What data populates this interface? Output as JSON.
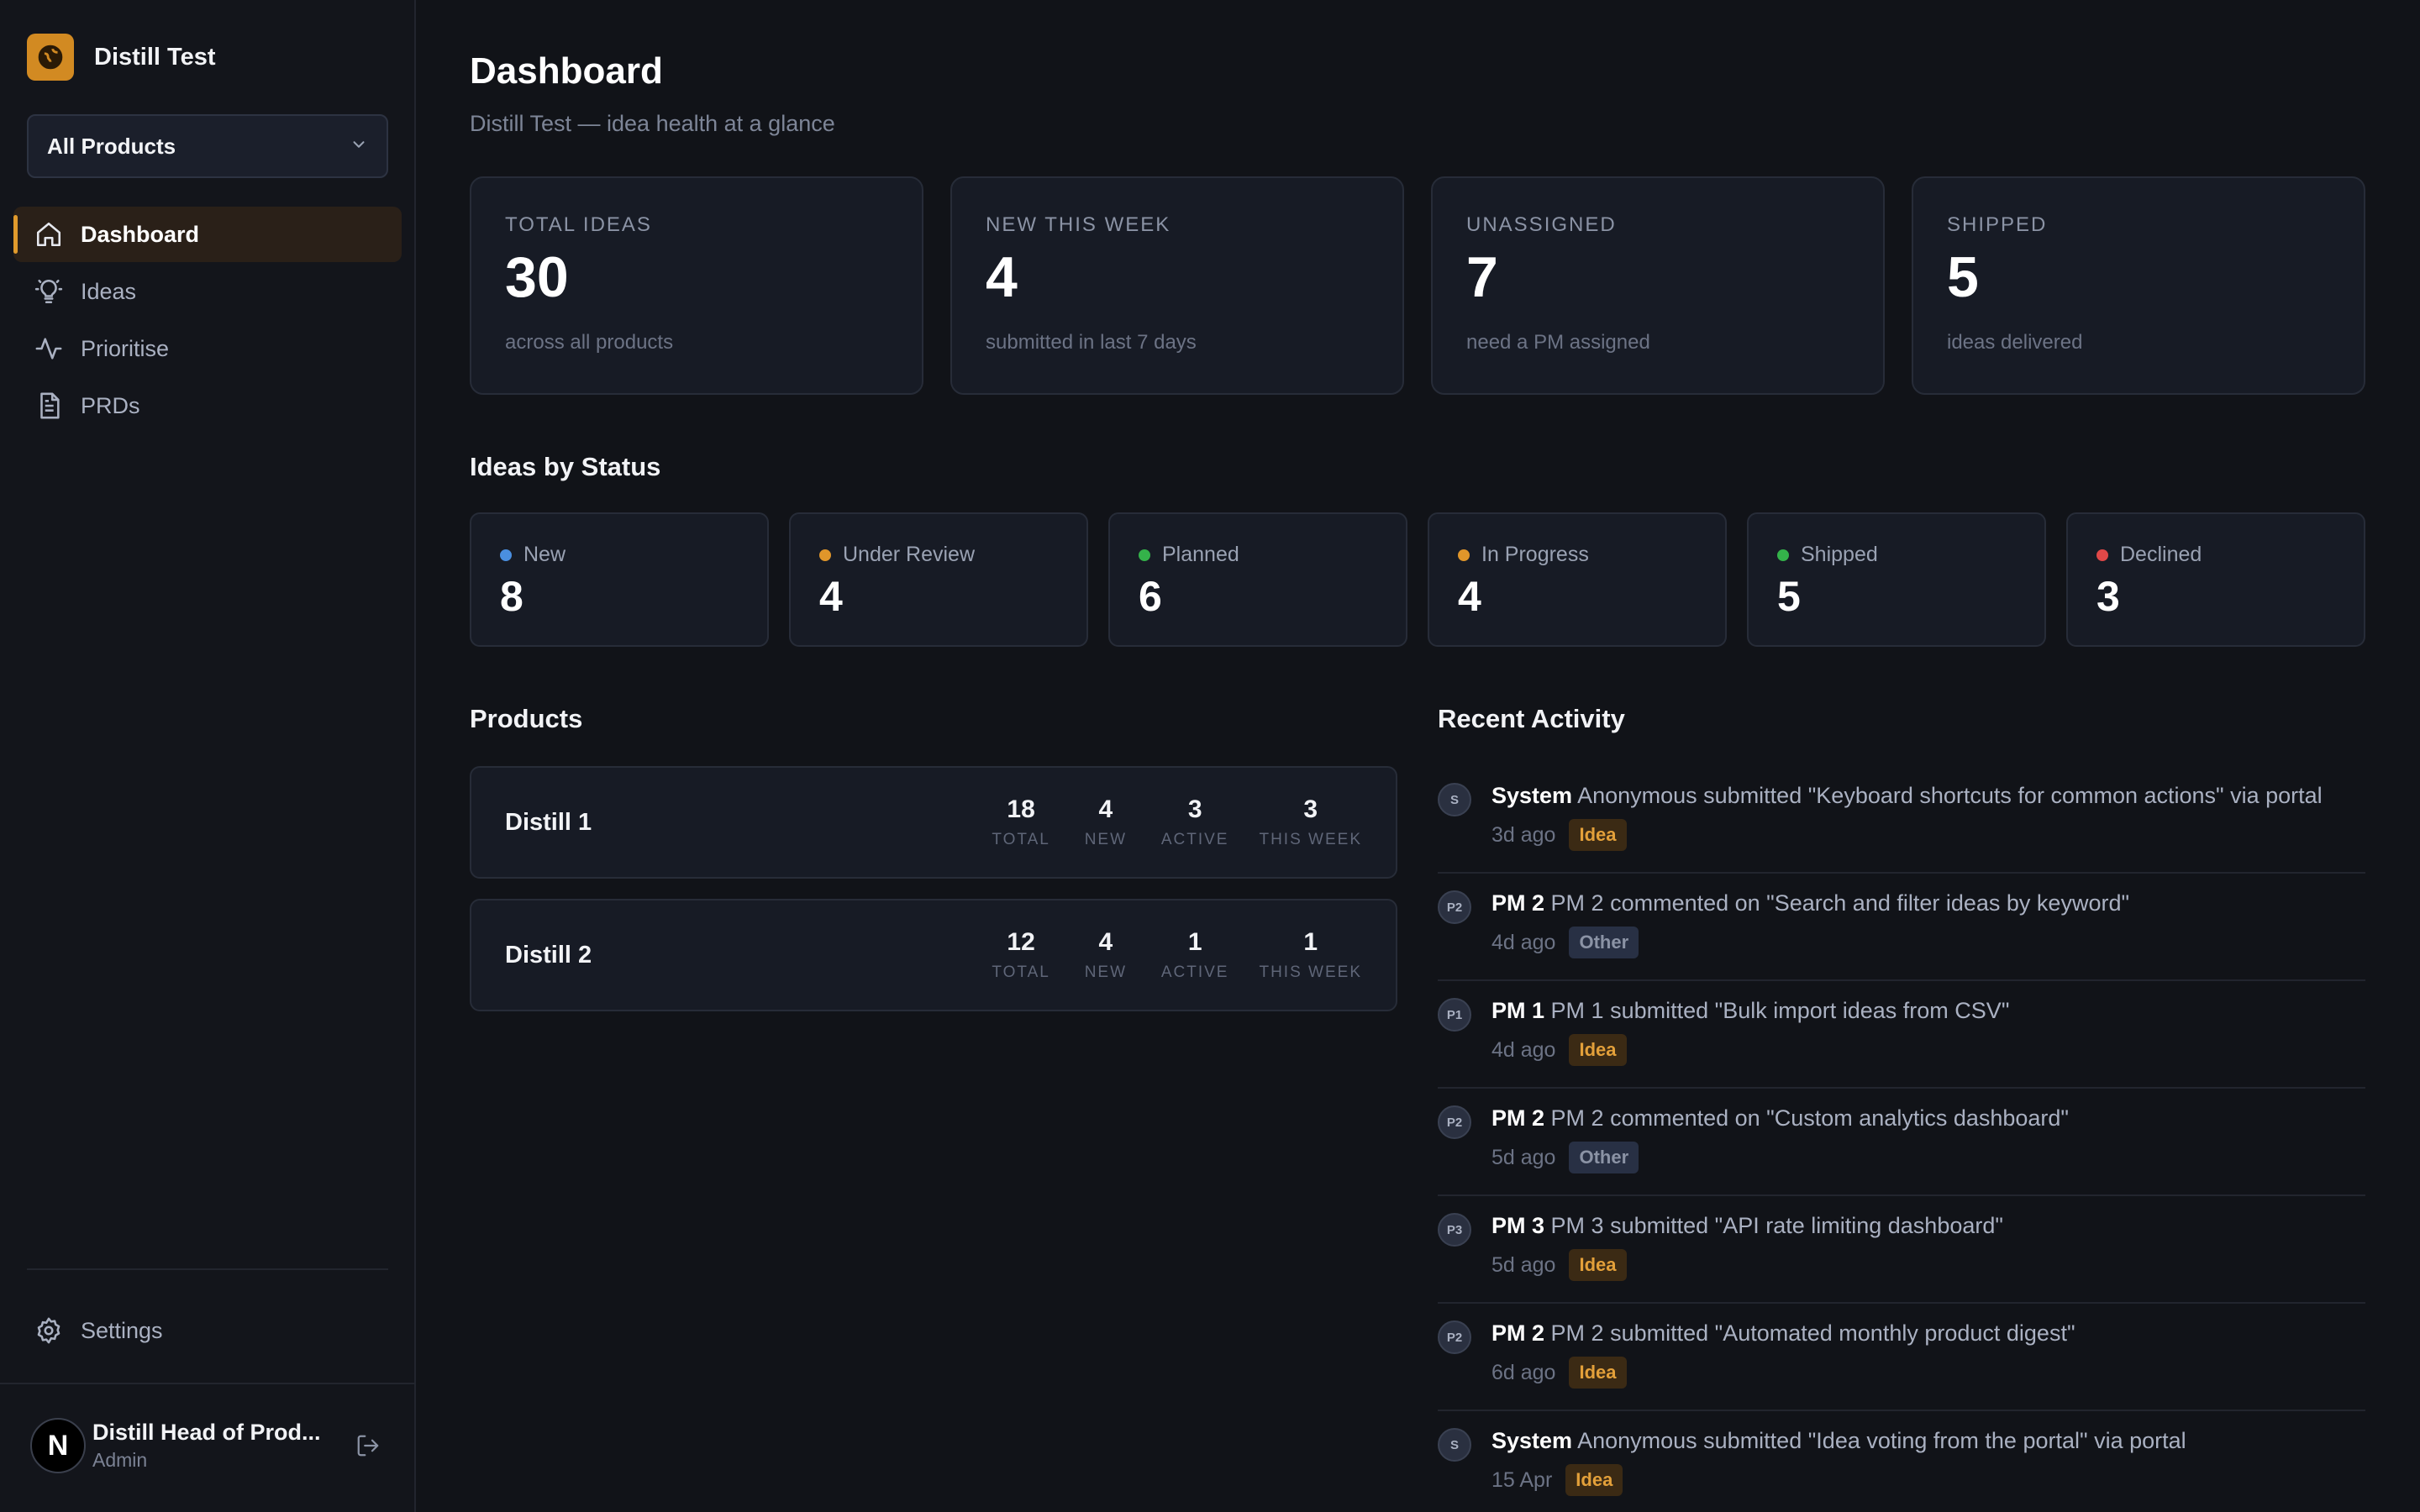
{
  "app": {
    "name": "Distill Test"
  },
  "product_select": {
    "value": "All Products"
  },
  "nav": {
    "items": [
      {
        "label": "Dashboard",
        "icon": "home-icon",
        "active": true
      },
      {
        "label": "Ideas",
        "icon": "lightbulb-icon",
        "active": false
      },
      {
        "label": "Prioritise",
        "icon": "activity-icon",
        "active": false
      },
      {
        "label": "PRDs",
        "icon": "document-icon",
        "active": false
      }
    ],
    "settings": "Settings"
  },
  "user": {
    "initial": "N",
    "name": "Distill Head of Prod...",
    "role": "Admin"
  },
  "page": {
    "title": "Dashboard",
    "subtitle": "Distill Test — idea health at a glance"
  },
  "kpis": [
    {
      "label": "TOTAL IDEAS",
      "value": "30",
      "note": "across all products"
    },
    {
      "label": "NEW THIS WEEK",
      "value": "4",
      "note": "submitted in last 7 days"
    },
    {
      "label": "UNASSIGNED",
      "value": "7",
      "note": "need a PM assigned"
    },
    {
      "label": "SHIPPED",
      "value": "5",
      "note": "ideas delivered"
    }
  ],
  "status_section": {
    "title": "Ideas by Status",
    "items": [
      {
        "label": "New",
        "value": "8",
        "color": "#4a8fe0"
      },
      {
        "label": "Under Review",
        "value": "4",
        "color": "#e0962a"
      },
      {
        "label": "Planned",
        "value": "6",
        "color": "#34b24a"
      },
      {
        "label": "In Progress",
        "value": "4",
        "color": "#e0962a"
      },
      {
        "label": "Shipped",
        "value": "5",
        "color": "#34b24a"
      },
      {
        "label": "Declined",
        "value": "3",
        "color": "#e04848"
      }
    ]
  },
  "products_section": {
    "title": "Products",
    "stat_labels": [
      "TOTAL",
      "NEW",
      "ACTIVE",
      "THIS WEEK"
    ],
    "items": [
      {
        "name": "Distill 1",
        "stats": [
          "18",
          "4",
          "3",
          "3"
        ]
      },
      {
        "name": "Distill 2",
        "stats": [
          "12",
          "4",
          "1",
          "1"
        ]
      }
    ]
  },
  "activity_section": {
    "title": "Recent Activity",
    "items": [
      {
        "badge": "S",
        "actor": "System",
        "text": "Anonymous submitted \"Keyboard shortcuts for common actions\" via portal",
        "time": "3d ago",
        "tag": "Idea"
      },
      {
        "badge": "P2",
        "actor": "PM 2",
        "text": "PM 2 commented on \"Search and filter ideas by keyword\"",
        "time": "4d ago",
        "tag": "Other"
      },
      {
        "badge": "P1",
        "actor": "PM 1",
        "text": "PM 1 submitted \"Bulk import ideas from CSV\"",
        "time": "4d ago",
        "tag": "Idea"
      },
      {
        "badge": "P2",
        "actor": "PM 2",
        "text": "PM 2 commented on \"Custom analytics dashboard\"",
        "time": "5d ago",
        "tag": "Other"
      },
      {
        "badge": "P3",
        "actor": "PM 3",
        "text": "PM 3 submitted \"API rate limiting dashboard\"",
        "time": "5d ago",
        "tag": "Idea"
      },
      {
        "badge": "P2",
        "actor": "PM 2",
        "text": "PM 2 submitted \"Automated monthly product digest\"",
        "time": "6d ago",
        "tag": "Idea"
      },
      {
        "badge": "S",
        "actor": "System",
        "text": "Anonymous submitted \"Idea voting from the portal\" via portal",
        "time": "15 Apr",
        "tag": "Idea"
      }
    ]
  },
  "colors": {
    "accent": "#e09a2c",
    "brand": "#d28a22",
    "background": "#111318"
  }
}
